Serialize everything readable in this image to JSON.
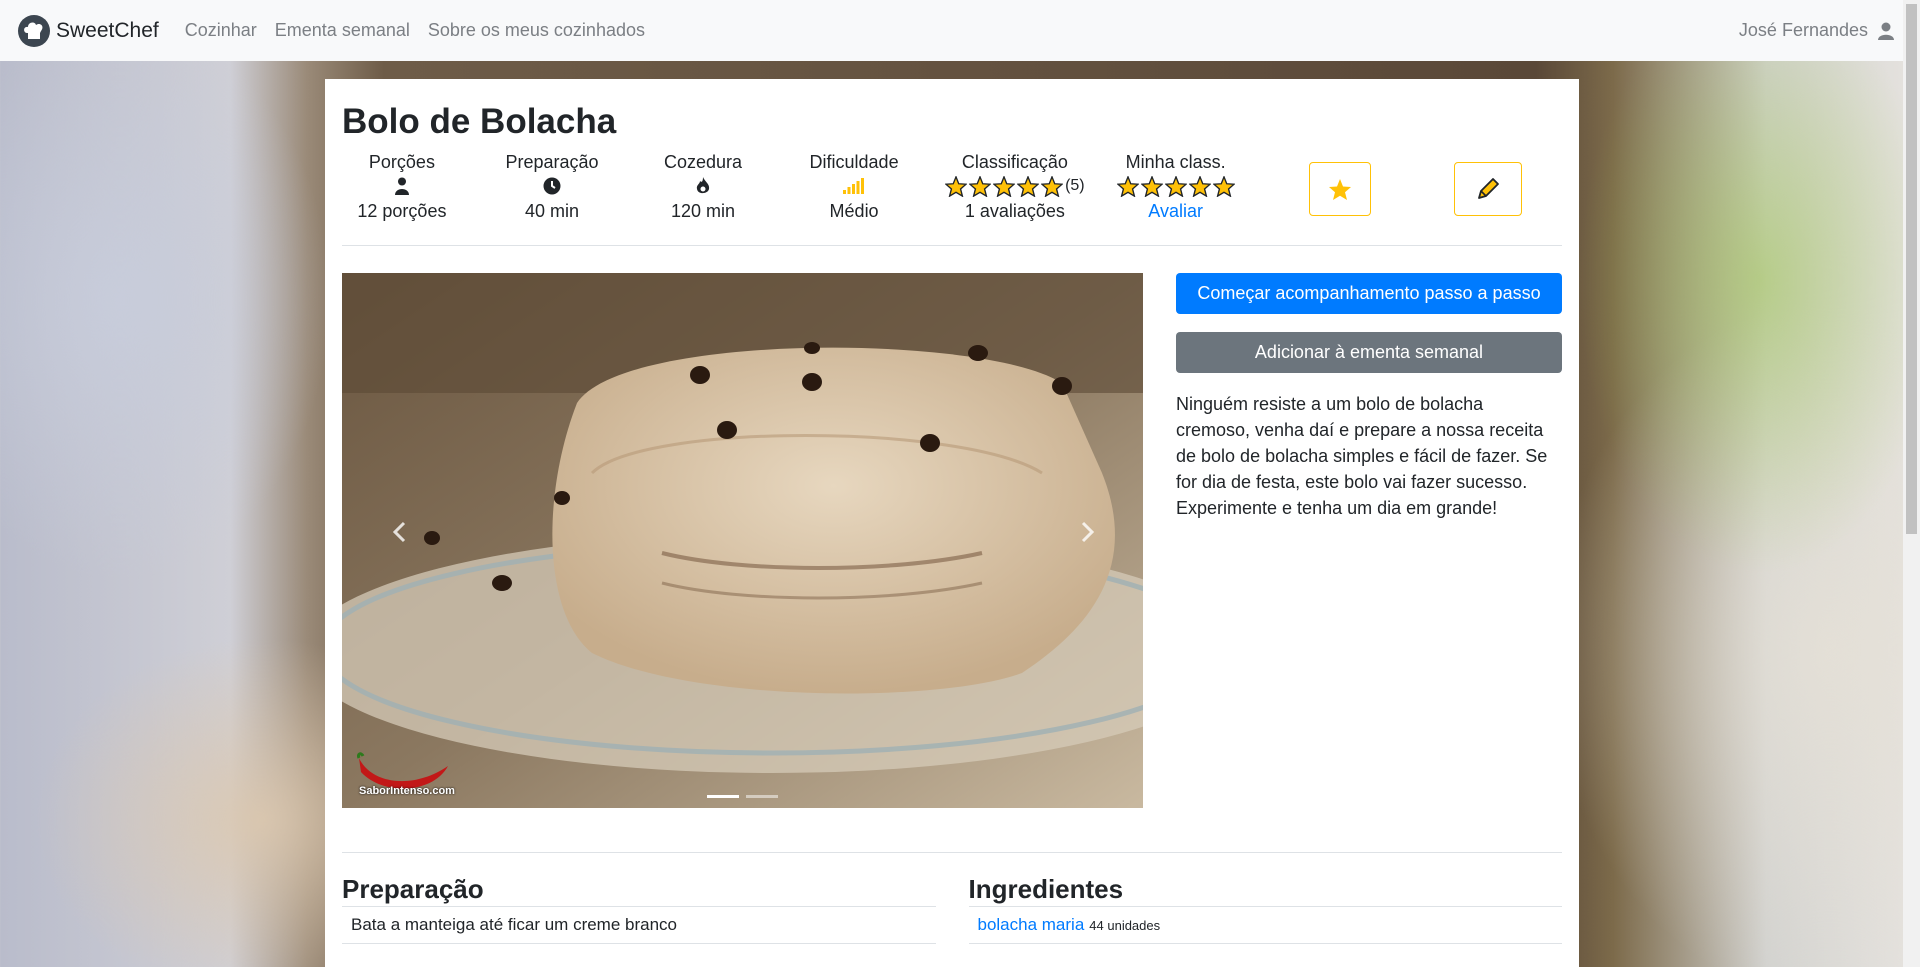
{
  "navbar": {
    "brand": "SweetChef",
    "links": [
      "Cozinhar",
      "Ementa semanal",
      "Sobre os meus cozinhados"
    ],
    "user": "José Fernandes"
  },
  "recipe": {
    "title": "Bolo de Bolacha",
    "stats": {
      "portions_label": "Porções",
      "portions_value": "12 porções",
      "prep_label": "Preparação",
      "prep_value": "40 min",
      "cook_label": "Cozedura",
      "cook_value": "120 min",
      "difficulty_label": "Dificuldade",
      "difficulty_value": "Médio",
      "rating_label": "Classificação",
      "rating_count_stars": "(5)",
      "rating_reviews": "1 avaliações",
      "my_rating_label": "Minha class.",
      "rate_link": "Avaliar"
    },
    "actions": {
      "start_button": "Começar acompanhamento passo a passo",
      "add_menu_button": "Adicionar à ementa semanal"
    },
    "description": "Ninguém resiste a um bolo de bolacha cremoso, venha daí e prepare a nossa receita de bolo de bolacha simples e fácil de fazer. Se for dia de festa, este bolo vai fazer sucesso. Experimente e tenha um dia em grande!",
    "carousel": {
      "watermark": "SaborIntenso.com",
      "slides": 2,
      "active_slide": 1
    }
  },
  "preparation": {
    "heading": "Preparação",
    "steps": [
      "Bata a manteiga até ficar um creme branco"
    ]
  },
  "ingredients": {
    "heading": "Ingredientes",
    "items": [
      {
        "name": "bolacha maria",
        "qty": "44 unidades"
      }
    ]
  },
  "colors": {
    "primary": "#007bff",
    "secondary": "#6c757d",
    "warning": "#ffc107"
  }
}
